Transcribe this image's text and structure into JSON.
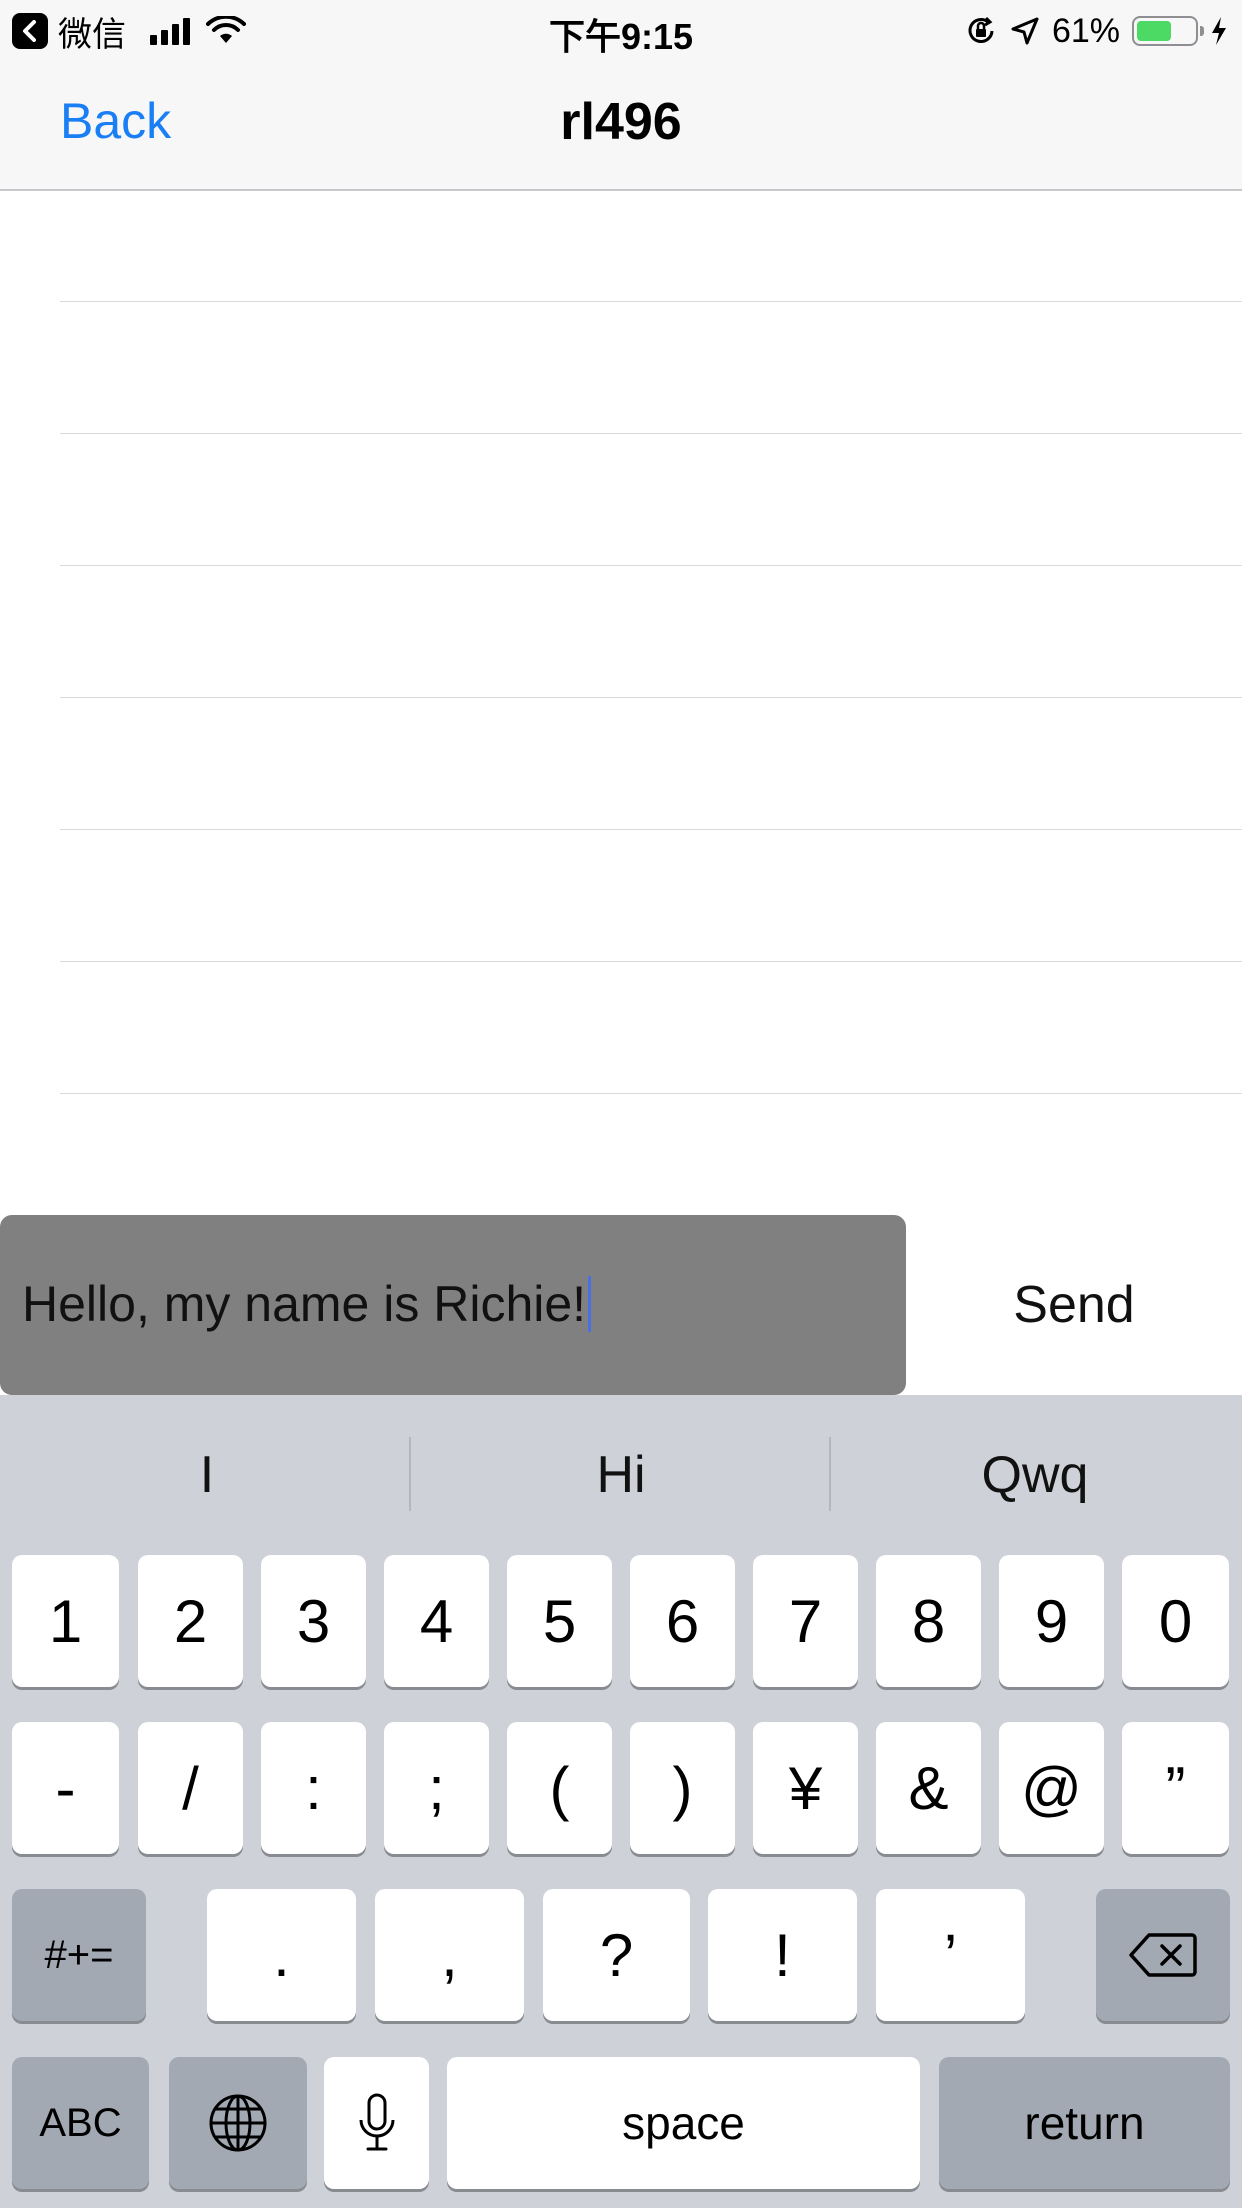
{
  "status_bar": {
    "app": "微信",
    "time": "下午9:15",
    "battery_percent": "61%",
    "battery_level": 0.61,
    "battery_color": "#4cd964",
    "icons": [
      "back-arrow-icon",
      "signal-icon",
      "wifi-icon",
      "orientation-lock-icon",
      "location-icon",
      "battery-icon",
      "charging-bolt-icon"
    ]
  },
  "nav": {
    "back_label": "Back",
    "title": "rl496"
  },
  "messages": {
    "rows": [
      "",
      "",
      "",
      "",
      "",
      "",
      ""
    ]
  },
  "composer": {
    "input_value": "Hello, my name is Richie!",
    "send_label": "Send"
  },
  "keyboard": {
    "suggestions": [
      "I",
      "Hi",
      "Qwq"
    ],
    "row1": [
      "1",
      "2",
      "3",
      "4",
      "5",
      "6",
      "7",
      "8",
      "9",
      "0"
    ],
    "row2": [
      "-",
      "/",
      ":",
      ";",
      "(",
      ")",
      "¥",
      "&",
      "@",
      "”"
    ],
    "row3_mode_label": "#+=",
    "row3": [
      ".",
      ",",
      "?",
      "!",
      "’"
    ],
    "abc_label": "ABC",
    "space_label": "space",
    "return_label": "return",
    "icons": [
      "globe-icon",
      "microphone-icon",
      "delete-icon"
    ]
  },
  "colors": {
    "accent": "#1a7ff5",
    "input_bg": "#808080",
    "keyboard_bg": "#ced1d8"
  }
}
